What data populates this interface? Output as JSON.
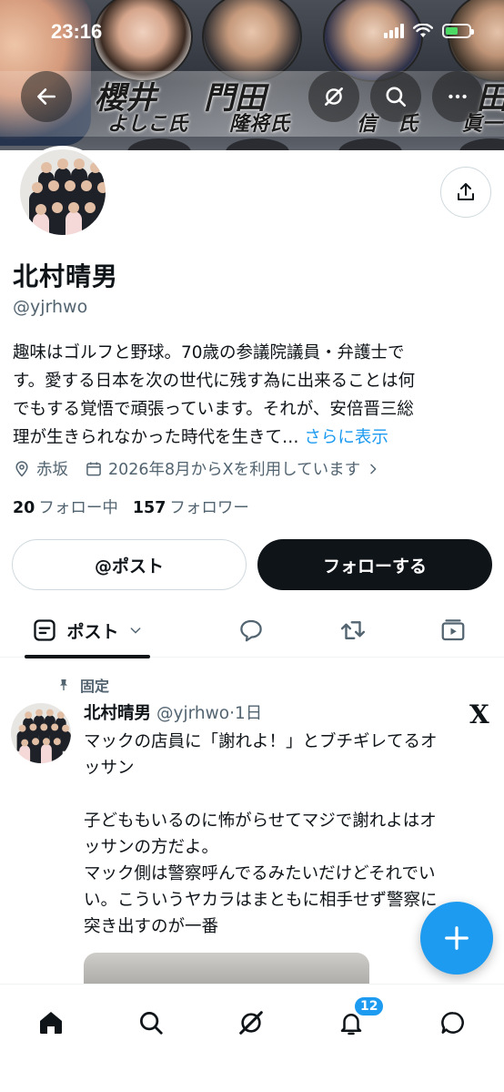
{
  "status_bar": {
    "time": "23:16"
  },
  "banner": {
    "names_big": [
      "櫻井",
      "門田",
      "田"
    ],
    "names_small": [
      "よしこ氏",
      "隆将氏",
      "信",
      "氏",
      "眞一"
    ]
  },
  "profile": {
    "display_name": "北村晴男",
    "handle": "@yjrhwo",
    "bio_lines": [
      "趣味はゴルフと野球。70歳の参議院議員・弁護士で",
      "す。愛する日本を次の世代に残す為に出来ることは何",
      "でもする覚悟で頑張っています。それが、安倍晋三総",
      "理が生きられなかった時代を生きて…"
    ],
    "bio_more": "さらに表示",
    "location": "赤坂",
    "joined": "2026年8月からXを利用しています",
    "following_count": "20",
    "following_label": "フォロー中",
    "followers_count": "157",
    "followers_label": "フォロワー"
  },
  "buttons": {
    "mention_post": "@ポスト",
    "follow": "フォローする"
  },
  "tabs": {
    "posts_label": "ポスト"
  },
  "post": {
    "pinned_label": "固定",
    "author_name": "北村晴男",
    "author_handle": "@yjrhwo",
    "time": "·1日",
    "lines": [
      "マックの店員に「謝れよ！」とブチギレてるオ",
      "ッサン",
      "",
      "子どももいるのに怖がらせてマジで謝れよはオ",
      "ッサンの方だよ。",
      "マック側は警察呼んでるみたいだけどそれでい",
      "い。こういうヤカラはまともに相手せず警察に",
      "突き出すのが一番"
    ],
    "x_logo": "X"
  },
  "bottom_nav": {
    "notification_count": "12"
  },
  "colors": {
    "accent": "#1d9bf0",
    "text": "#0f1419",
    "secondary": "#536471",
    "border": "#cfd9de"
  },
  "icons": [
    "back-arrow-icon",
    "grok-icon",
    "search-icon",
    "more-icon",
    "share-icon",
    "location-icon",
    "calendar-icon",
    "chevron-right-icon",
    "post-tab-icon",
    "chevron-down-icon",
    "reply-icon",
    "repost-icon",
    "media-icon",
    "pin-icon",
    "x-logo-icon",
    "plus-icon",
    "home-icon",
    "bell-icon",
    "messages-icon"
  ]
}
